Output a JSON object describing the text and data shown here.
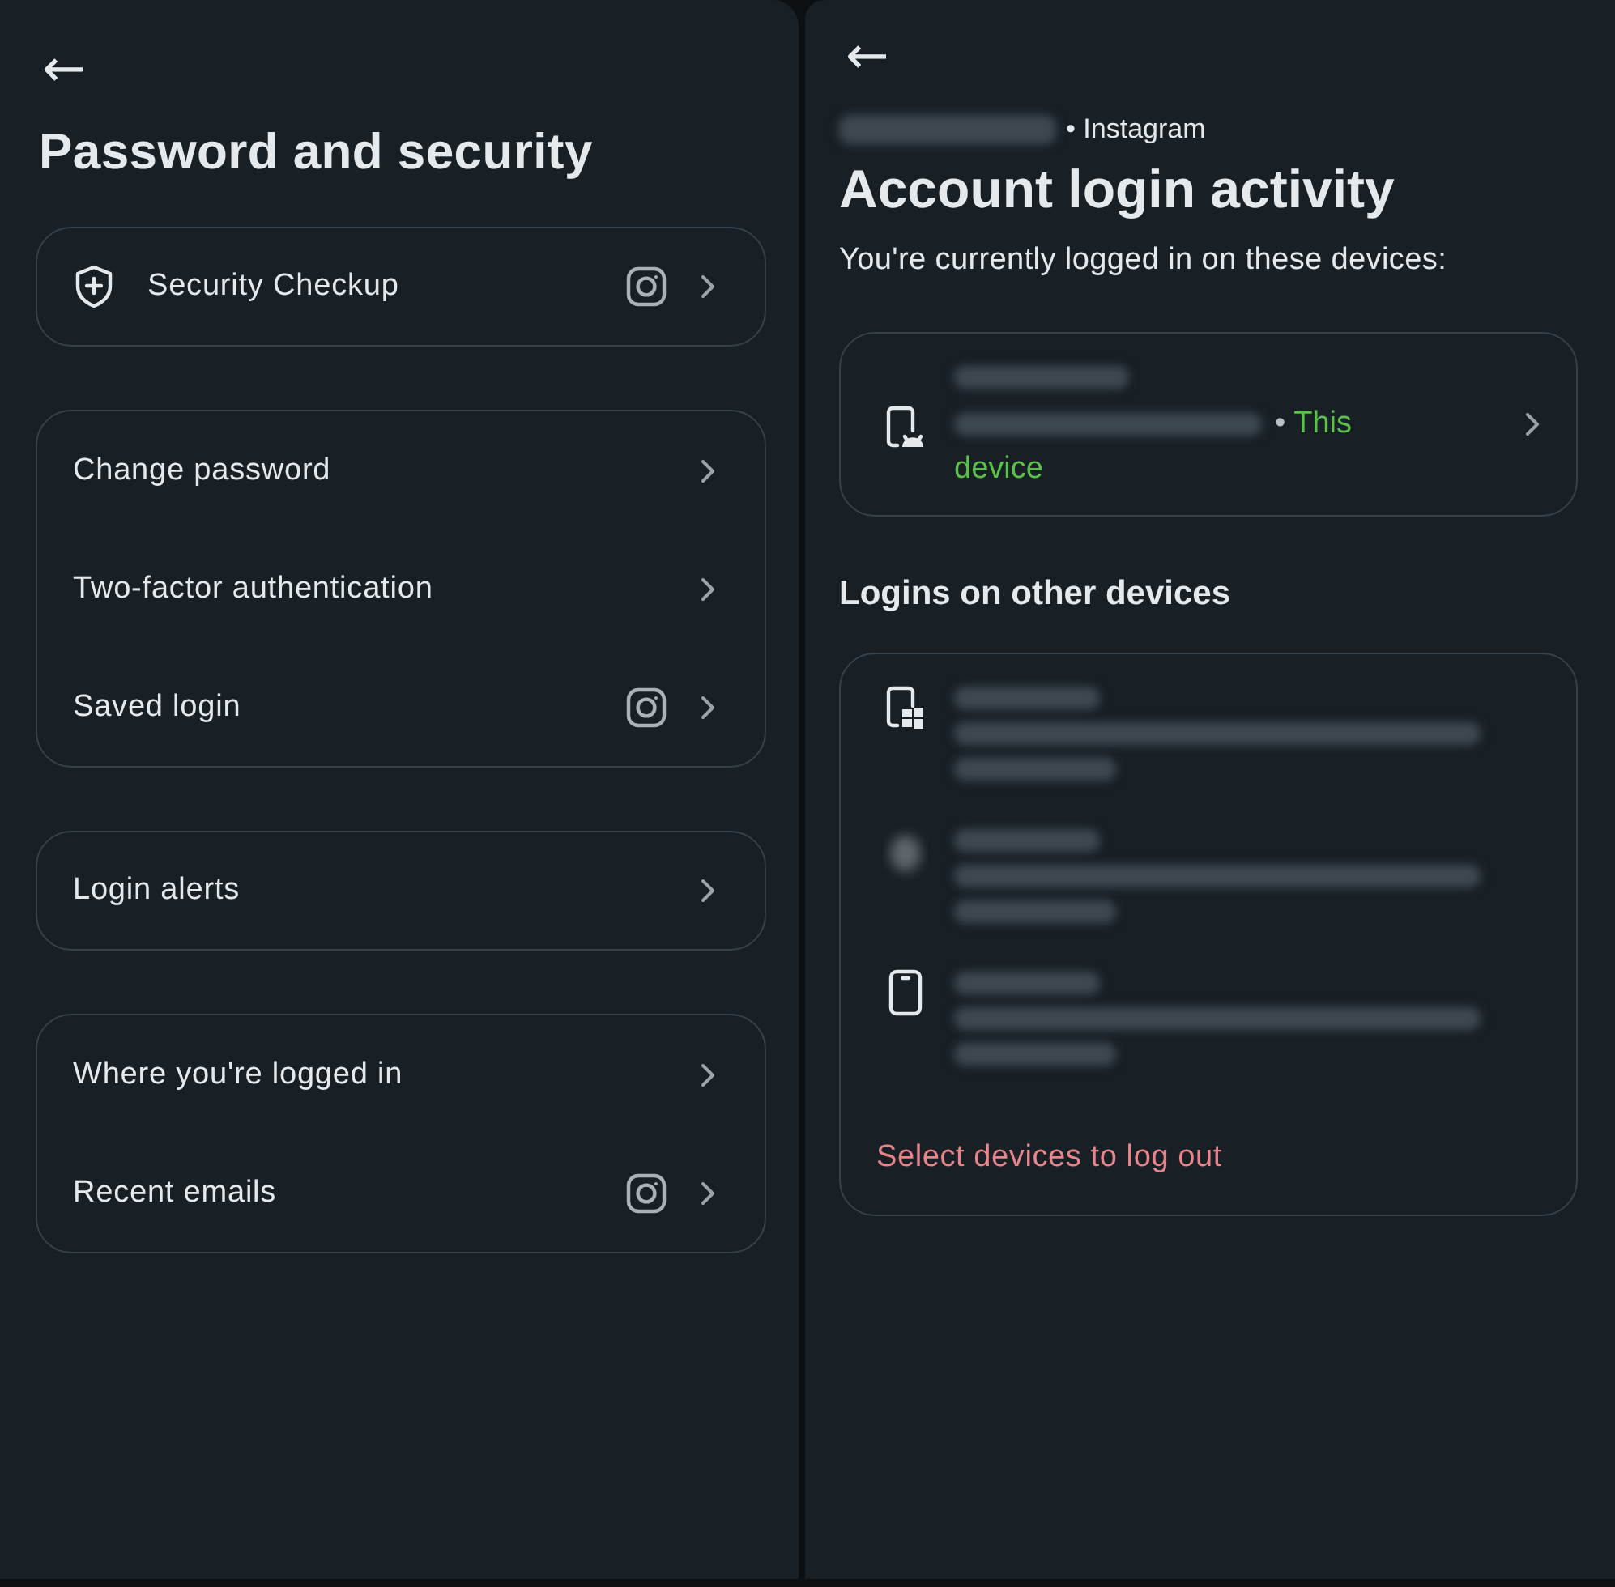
{
  "password_screen": {
    "back": "←",
    "title": "Password and security",
    "groups": [
      {
        "items": [
          {
            "label": "Security Checkup",
            "kind": "shield",
            "instagram": true
          }
        ]
      },
      {
        "items": [
          {
            "label": "Change password",
            "kind": "plain",
            "instagram": false
          },
          {
            "label": "Two-factor authentication",
            "kind": "plain",
            "instagram": false
          },
          {
            "label": "Saved login",
            "kind": "plain",
            "instagram": true
          }
        ]
      },
      {
        "items": [
          {
            "label": "Login alerts",
            "kind": "plain",
            "instagram": false
          }
        ]
      },
      {
        "items": [
          {
            "label": "Where you're logged in",
            "kind": "plain",
            "instagram": false
          },
          {
            "label": "Recent emails",
            "kind": "plain",
            "instagram": true
          }
        ]
      }
    ]
  },
  "login_activity_screen": {
    "back": "←",
    "account": "• Instagram",
    "title": "Account login activity",
    "subtitle": "You're currently logged in on these devices:",
    "current_device": {
      "kind": "android",
      "separator": "•",
      "status": "This device"
    },
    "other_heading": "Logins on other devices",
    "other_devices": [
      {
        "kind": "windows"
      },
      {
        "kind": "hidden"
      },
      {
        "kind": "phone"
      }
    ],
    "logout_link": "Select devices to log out"
  }
}
